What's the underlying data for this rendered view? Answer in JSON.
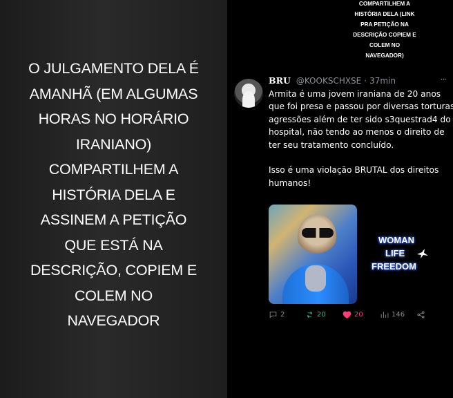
{
  "left_panel": {
    "lines": [
      "O JULGAMENTO DELA É",
      "AMANHÃ (EM ALGUMAS",
      "HORAS NO HORÁRIO",
      "IRANIANO)",
      "COMPARTILHEM A",
      "HISTÓRIA DELA E",
      "ASSINEM A PETIÇÃO",
      "QUE ESTÁ NA",
      "DESCRIÇÃO, COPIEM E",
      "COLEM NO",
      "NAVEGADOR"
    ]
  },
  "right_panel": {
    "top_caption": [
      "COMPARTILHEM A",
      "HISTÓRIA DELA (LINK",
      "PRA PETIÇÃO NA",
      "DESCRIÇÃO COPIEM E",
      "COLEM NO",
      "NAVEGADOR)"
    ],
    "tweet": {
      "author_name": "BRU",
      "handle": "@KOOKSCHXSE",
      "dot": "·",
      "time": "37min",
      "more": "···",
      "body": "Armita é uma jovem iraniana de 20 anos que foi presa e passou por diversas torturas, agressões além de ter sido s3questrad4 do hospital, não tendo ao menos o direito de ter seu tratamento concluído.\n\n Isso é uma violação BRUTAL dos direitos humanos!",
      "overlay": [
        "WOMAN",
        "LIFE",
        "FREEDOM"
      ],
      "replies": "2",
      "retweets": "20",
      "likes": "20",
      "views": "146"
    }
  },
  "colors": {
    "background": "#000000",
    "muted": "#8b8f95",
    "retweet": "#4caf9b",
    "like": "#ff3b7f",
    "overlay_glow": "#3e6cff"
  }
}
